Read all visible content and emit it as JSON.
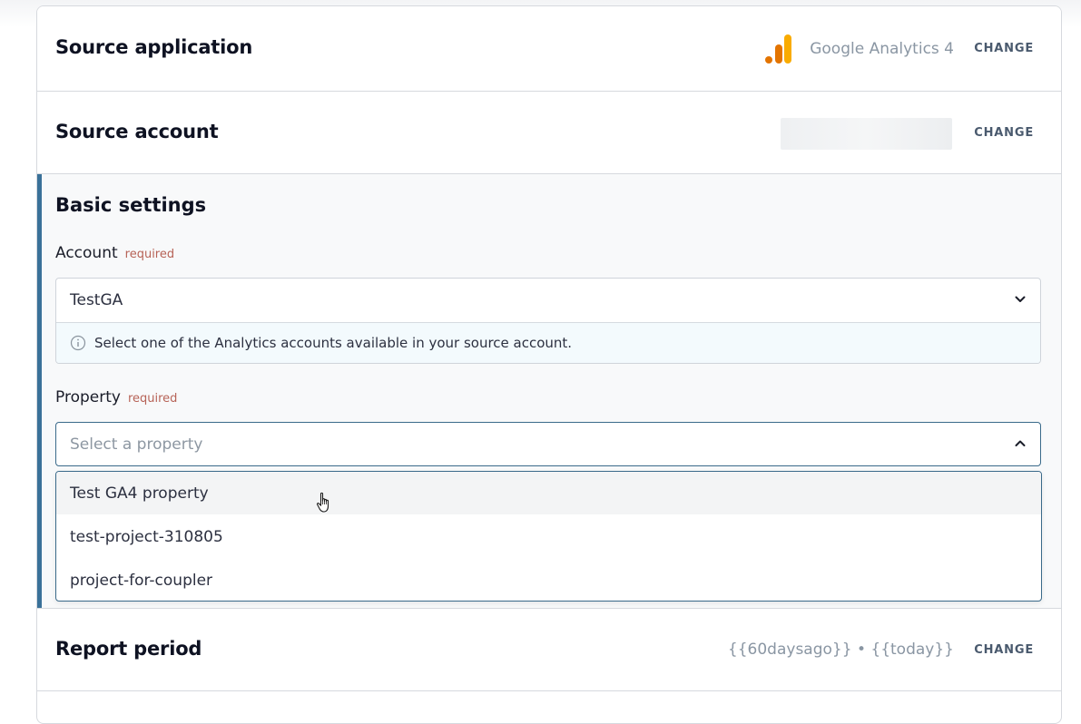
{
  "source_application": {
    "title": "Source application",
    "app_name": "Google Analytics 4",
    "app_icon": "google-analytics-icon",
    "change_label": "CHANGE"
  },
  "source_account": {
    "title": "Source account",
    "change_label": "CHANGE"
  },
  "basic_settings": {
    "title": "Basic settings",
    "accent_color": "#3a7199",
    "account": {
      "label": "Account",
      "required": "required",
      "value": "TestGA",
      "hint": "Select one of the Analytics accounts available in your source account.",
      "hint_icon": "info-icon"
    },
    "property": {
      "label": "Property",
      "required": "required",
      "placeholder": "Select a property",
      "options": [
        "Test GA4 property",
        "test-project-310805",
        "project-for-coupler"
      ]
    }
  },
  "report_period": {
    "title": "Report period",
    "value": "{{60daysago}} • {{today}}",
    "change_label": "CHANGE"
  },
  "colors": {
    "ga_orange_dark": "#e37400",
    "ga_orange_light": "#f9ab00",
    "required_text": "#b76357"
  }
}
